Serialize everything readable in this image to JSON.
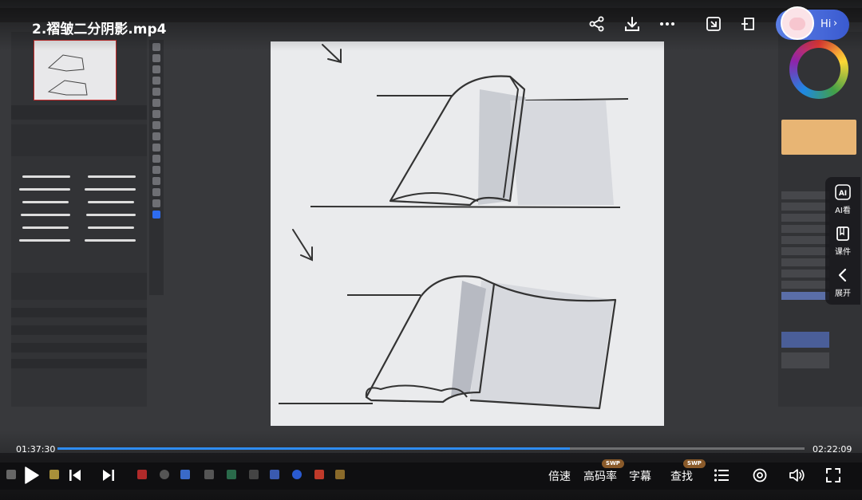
{
  "video": {
    "title": "2.褶皱二分阴影.mp4",
    "current_time": "01:37:30",
    "total_time": "02:22:09",
    "progress": 0.686
  },
  "header": {
    "icons": [
      "share-icon",
      "download-icon",
      "more-icon",
      "screenshot-icon",
      "pip-icon"
    ],
    "assistant_label": "Hi"
  },
  "side_panel": {
    "items": [
      {
        "icon": "ai-look-icon",
        "label": "AI看"
      },
      {
        "icon": "courseware-icon",
        "label": "课件"
      },
      {
        "icon": "chevron-left-icon",
        "label": "展开"
      }
    ]
  },
  "controls": {
    "speed_label": "倍速",
    "quality_label": "高码率",
    "subtitle_label": "字幕",
    "search_label": "查找",
    "badge_label": "SWP"
  },
  "colors": {
    "accent": "#2e8cf0",
    "badge": "#8a5a2a",
    "swatch": "#e8b574"
  }
}
